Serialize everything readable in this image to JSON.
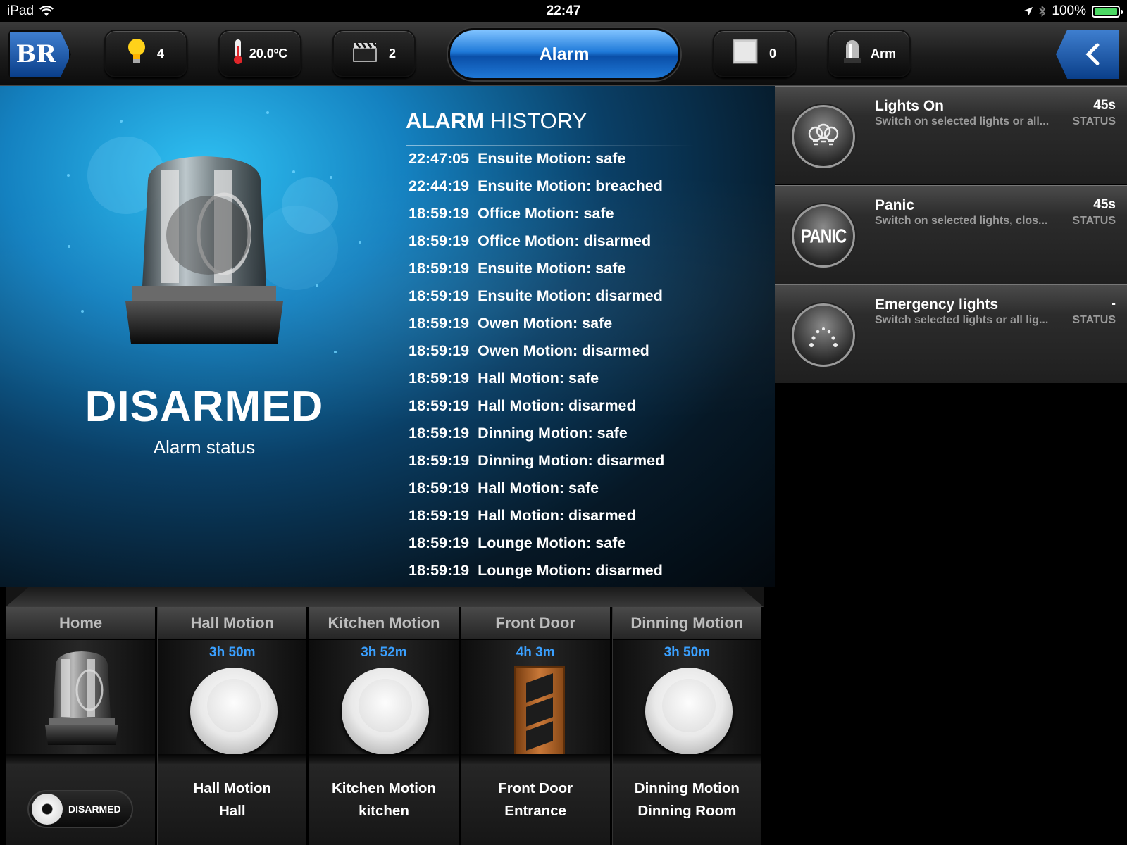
{
  "status_bar": {
    "device": "iPad",
    "time": "22:47",
    "battery": "100%"
  },
  "toolbar": {
    "home_logo": "BR",
    "lights_count": "4",
    "temperature": "20.0ºC",
    "scenes_count": "2",
    "title": "Alarm",
    "blinds_count": "0",
    "arm_label": "Arm",
    "back_icon": "chevron-left-icon"
  },
  "alarm": {
    "status": "DISARMED",
    "status_label": "Alarm status"
  },
  "history": {
    "title_bold": "ALARM",
    "title_rest": "HISTORY",
    "entries": [
      {
        "time": "22:47:05",
        "event": "Ensuite Motion: safe"
      },
      {
        "time": "22:44:19",
        "event": "Ensuite Motion: breached"
      },
      {
        "time": "18:59:19",
        "event": "Office Motion: safe"
      },
      {
        "time": "18:59:19",
        "event": "Office Motion: disarmed"
      },
      {
        "time": "18:59:19",
        "event": "Ensuite Motion: safe"
      },
      {
        "time": "18:59:19",
        "event": "Ensuite Motion: disarmed"
      },
      {
        "time": "18:59:19",
        "event": "Owen Motion: safe"
      },
      {
        "time": "18:59:19",
        "event": "Owen Motion: disarmed"
      },
      {
        "time": "18:59:19",
        "event": "Hall Motion: safe"
      },
      {
        "time": "18:59:19",
        "event": "Hall Motion: disarmed"
      },
      {
        "time": "18:59:19",
        "event": "Dinning Motion: safe"
      },
      {
        "time": "18:59:19",
        "event": "Dinning Motion: disarmed"
      },
      {
        "time": "18:59:19",
        "event": "Hall Motion: safe"
      },
      {
        "time": "18:59:19",
        "event": "Hall Motion: disarmed"
      },
      {
        "time": "18:59:19",
        "event": "Lounge Motion: safe"
      },
      {
        "time": "18:59:19",
        "event": "Lounge Motion: disarmed"
      }
    ]
  },
  "scenes": [
    {
      "title": "Lights On",
      "desc": "Switch on selected lights or all...",
      "time": "45s",
      "status": "STATUS",
      "icon": "bulbs-icon"
    },
    {
      "title": "Panic",
      "desc": "Switch on selected lights, clos...",
      "time": "45s",
      "status": "STATUS",
      "icon": "panic-icon",
      "icon_text": "PANIC"
    },
    {
      "title": "Emergency lights",
      "desc": "Switch selected lights or all lig...",
      "time": "-",
      "status": "STATUS",
      "icon": "emergency-dots-icon"
    }
  ],
  "devices": {
    "home": {
      "header": "Home",
      "toggle_label": "DISARMED"
    },
    "items": [
      {
        "header": "Hall Motion",
        "time": "3h 50m",
        "name": "Hall Motion",
        "location": "Hall"
      },
      {
        "header": "Kitchen Motion",
        "time": "3h 52m",
        "name": "Kitchen Motion",
        "location": "kitchen"
      },
      {
        "header": "Front Door",
        "time": "4h 3m",
        "name": "Front Door",
        "location": "Entrance"
      },
      {
        "header": "Dinning Motion",
        "time": "3h 50m",
        "name": "Dinning Motion",
        "location": "Dinning Room"
      }
    ]
  },
  "colors": {
    "accent_blue": "#1f7ad9",
    "time_blue": "#3aa0ff",
    "battery_green": "#4cd964"
  }
}
